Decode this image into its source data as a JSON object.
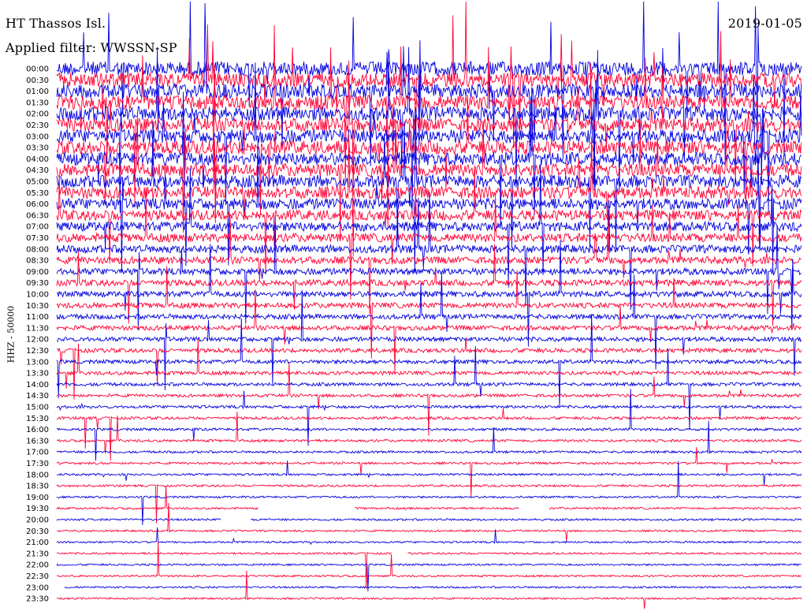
{
  "header": {
    "station": "HT Thassos Isl.",
    "date": "2019-01-05",
    "filter": "Applied filter: WWSSN-SP",
    "channel_label": "HHZ - 50000"
  },
  "chart_data": {
    "type": "line",
    "title": "HT Thassos Isl.",
    "subtitle": "Applied filter: WWSSN-SP",
    "ylabel": "HHZ - 50000",
    "row_labels": [
      "00:00",
      "00:30",
      "01:00",
      "01:30",
      "02:00",
      "02:30",
      "03:00",
      "03:30",
      "04:00",
      "04:30",
      "05:00",
      "05:30",
      "06:00",
      "06:30",
      "07:00",
      "07:30",
      "08:00",
      "08:30",
      "09:00",
      "09:30",
      "10:00",
      "10:30",
      "11:00",
      "11:30",
      "12:00",
      "12:30",
      "13:00",
      "13:30",
      "14:00",
      "14:30",
      "15:00",
      "15:30",
      "16:00",
      "16:30",
      "17:00",
      "17:30",
      "18:00",
      "18:30",
      "19:00",
      "19:30",
      "20:00",
      "20:30",
      "21:00",
      "21:30",
      "22:00",
      "22:30",
      "23:00",
      "23:30"
    ],
    "series_colors": [
      "#0000e0",
      "#ff0033"
    ],
    "row_amplitude_relative": [
      1.0,
      1.0,
      1.0,
      1.0,
      0.98,
      0.96,
      0.95,
      0.95,
      0.92,
      0.9,
      0.88,
      0.85,
      0.78,
      0.72,
      0.66,
      0.6,
      0.55,
      0.5,
      0.46,
      0.43,
      0.4,
      0.37,
      0.35,
      0.33,
      0.31,
      0.29,
      0.27,
      0.25,
      0.23,
      0.21,
      0.2,
      0.19,
      0.18,
      0.17,
      0.16,
      0.16,
      0.15,
      0.15,
      0.14,
      0.14,
      0.14,
      0.13,
      0.13,
      0.13,
      0.13,
      0.13,
      0.13,
      0.13
    ],
    "spike_activity_relative": [
      1.0,
      0.95,
      0.9,
      0.85,
      0.8,
      0.78,
      0.75,
      0.72,
      0.7,
      0.68,
      0.66,
      0.64,
      0.62,
      0.6,
      0.58,
      0.56,
      0.54,
      0.52,
      0.5,
      0.48,
      0.46,
      0.44,
      0.42,
      0.4,
      0.38,
      0.36,
      0.34,
      0.32,
      0.3,
      0.28,
      0.26,
      0.24,
      0.22,
      0.2,
      0.18,
      0.16,
      0.15,
      0.14,
      0.13,
      0.12,
      0.11,
      0.1,
      0.1,
      0.1,
      0.1,
      0.1,
      0.1,
      0.1
    ],
    "data_gaps": [
      {
        "row": "19:30",
        "start_fraction": 0.27,
        "end_fraction": 0.4
      },
      {
        "row": "19:30",
        "start_fraction": 0.62,
        "end_fraction": 0.66
      },
      {
        "row": "20:00",
        "start_fraction": 0.22,
        "end_fraction": 0.26
      },
      {
        "row": "21:30",
        "start_fraction": 0.45,
        "end_fraction": 0.47
      },
      {
        "row": "23:00",
        "start_fraction": 0.0,
        "end_fraction": 0.01
      }
    ],
    "grid": false,
    "legend": "none"
  }
}
